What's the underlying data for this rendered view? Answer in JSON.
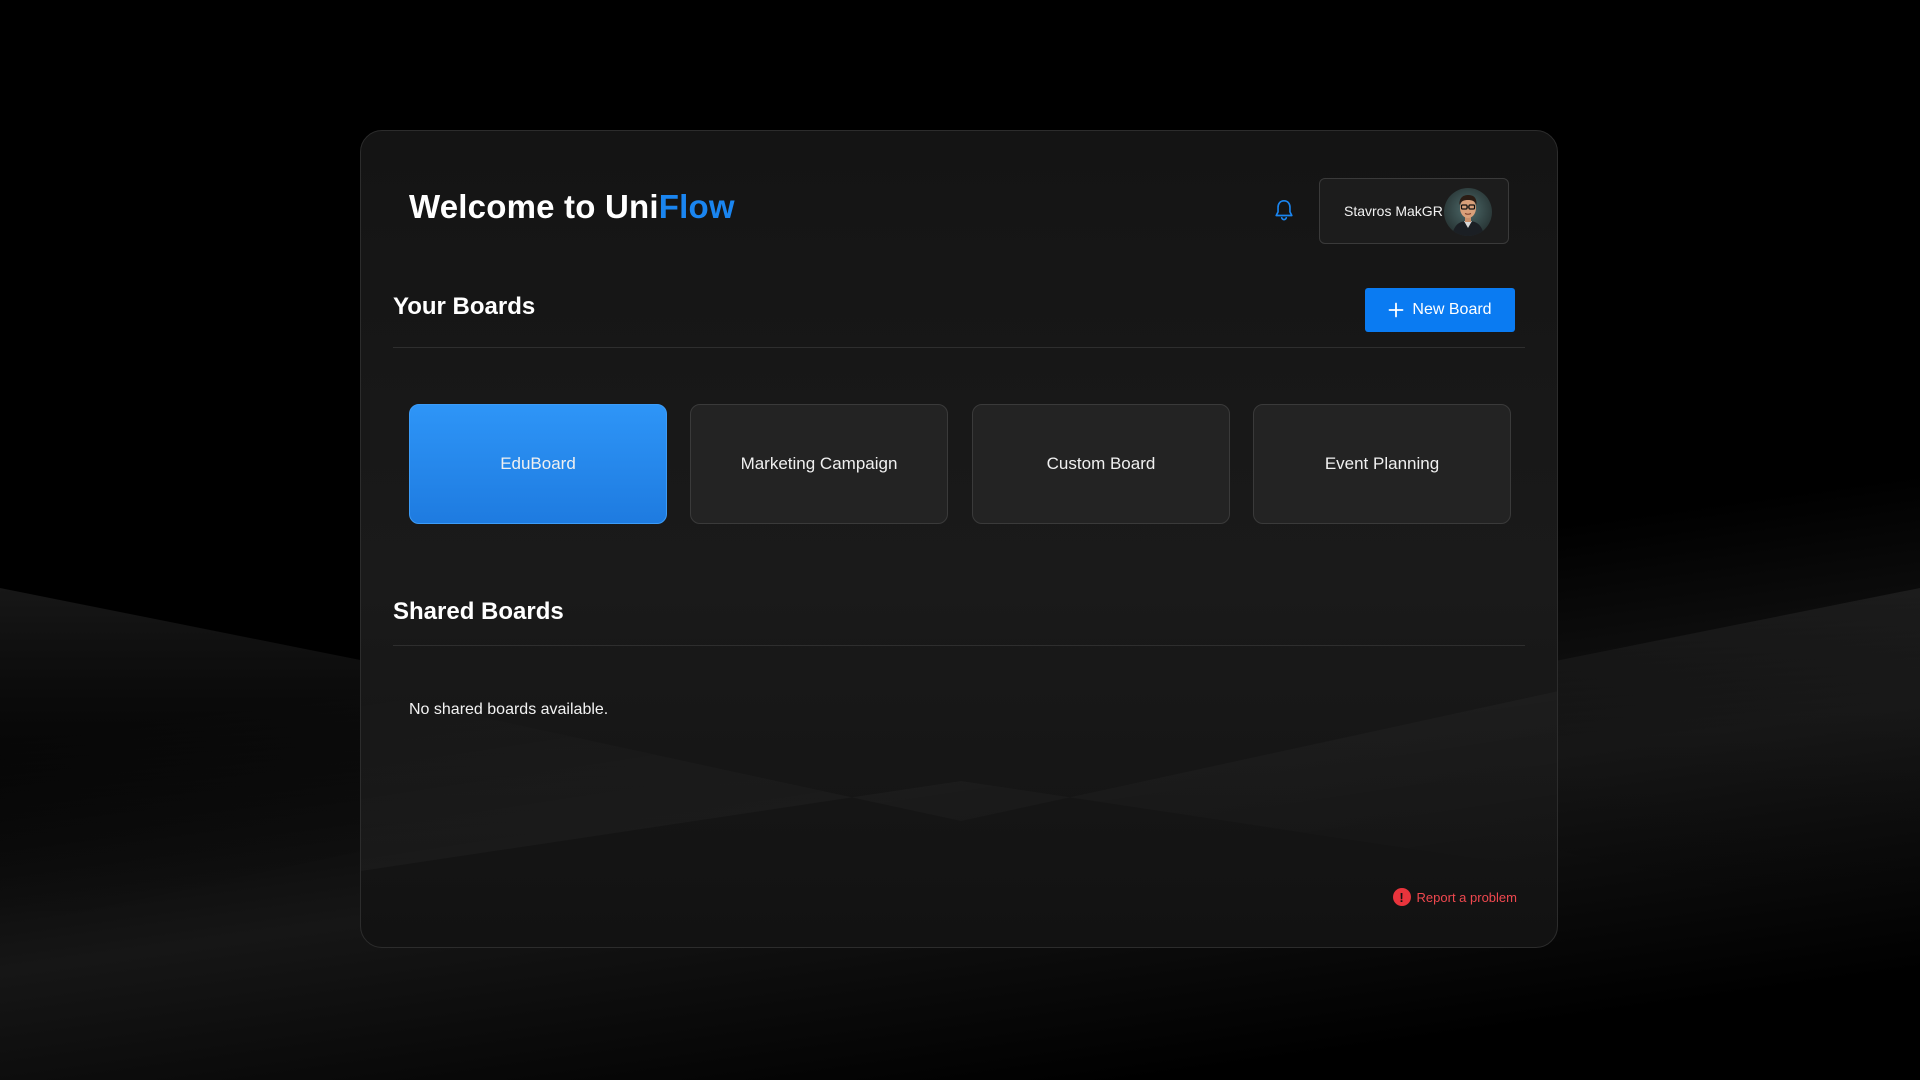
{
  "header": {
    "title_prefix": "Welcome to Uni",
    "title_accent": "Flow",
    "user_name": "Stavros MakGR",
    "notification_icon": "bell-icon",
    "avatar_icon": "user-avatar"
  },
  "your_boards": {
    "title": "Your Boards",
    "new_board_label": "New Board",
    "new_board_icon": "plus-icon",
    "boards": [
      {
        "label": "EduBoard",
        "active": true
      },
      {
        "label": "Marketing Campaign",
        "active": false
      },
      {
        "label": "Custom Board",
        "active": false
      },
      {
        "label": "Event Planning",
        "active": false
      }
    ]
  },
  "shared_boards": {
    "title": "Shared Boards",
    "empty_message": "No shared boards available."
  },
  "footer": {
    "report_label": "Report a problem",
    "report_icon": "alert-circle-icon"
  },
  "colors": {
    "accent": "#1a85f0",
    "button": "#0a7bf2",
    "active_card": "#2e95f7",
    "danger": "#f0484f"
  }
}
